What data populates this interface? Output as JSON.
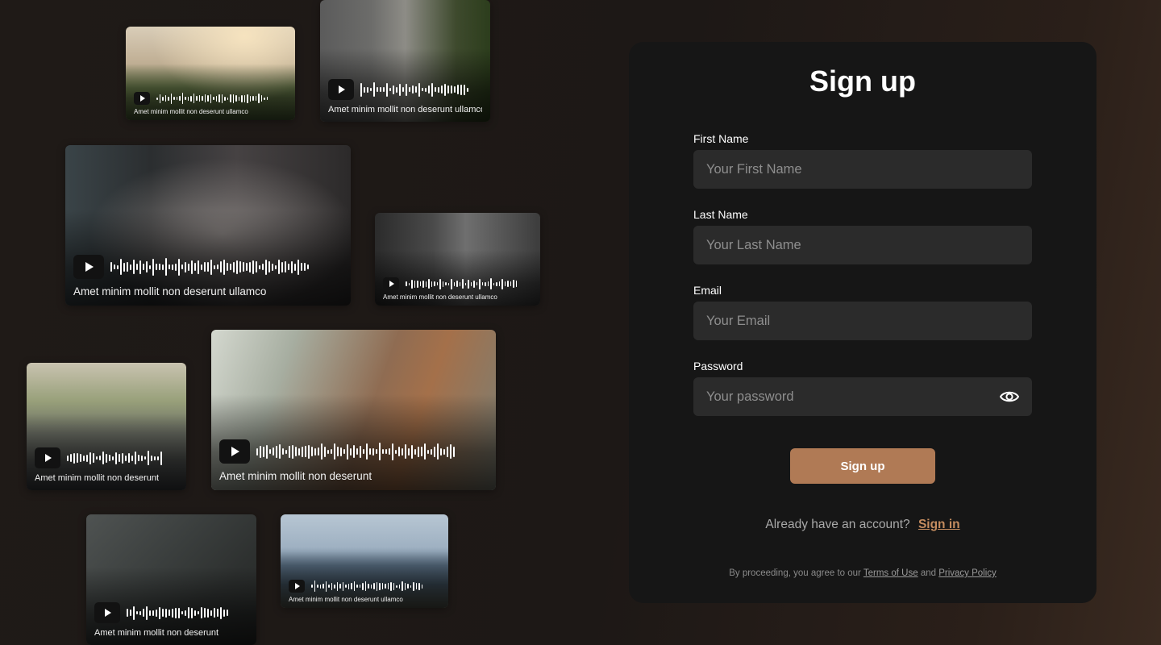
{
  "cards": [
    {
      "id": "c1",
      "caption": "Amet minim mollit non deserunt ullamco"
    },
    {
      "id": "c2",
      "caption": "Amet minim mollit non deserunt"
    },
    {
      "id": "c3",
      "caption": "Amet minim mollit non deserunt ullamco"
    },
    {
      "id": "c4",
      "caption": "Amet minim mollit non deserunt ullamco"
    },
    {
      "id": "c5",
      "caption": "Amet minim mollit non deserunt"
    },
    {
      "id": "c6",
      "caption": "Amet minim mollit non deserunt ullamco"
    },
    {
      "id": "c7",
      "caption": "Amet minim mollit non deserunt"
    },
    {
      "id": "c8",
      "caption": "Amet minim mollit non deserunt ullamco"
    }
  ],
  "form": {
    "title": "Sign up",
    "first_name_label": "First Name",
    "first_name_placeholder": "Your First Name",
    "last_name_label": "Last Name",
    "last_name_placeholder": "Your Last Name",
    "email_label": "Email",
    "email_placeholder": "Your Email",
    "password_label": "Password",
    "password_placeholder": "Your password",
    "submit_label": "Sign up",
    "already_text": "Already have an account?",
    "signin_link": "Sign in",
    "legal_prefix": "By proceeding, you agree to our",
    "terms_link": "Terms of Use",
    "legal_and": "and",
    "privacy_link": "Privacy Policy"
  },
  "colors": {
    "accent": "#b07a55",
    "link": "#c48c5f",
    "panel": "#161616",
    "input": "#2b2b2b"
  },
  "icons": {
    "play": "play-icon",
    "eye": "eye-icon"
  }
}
